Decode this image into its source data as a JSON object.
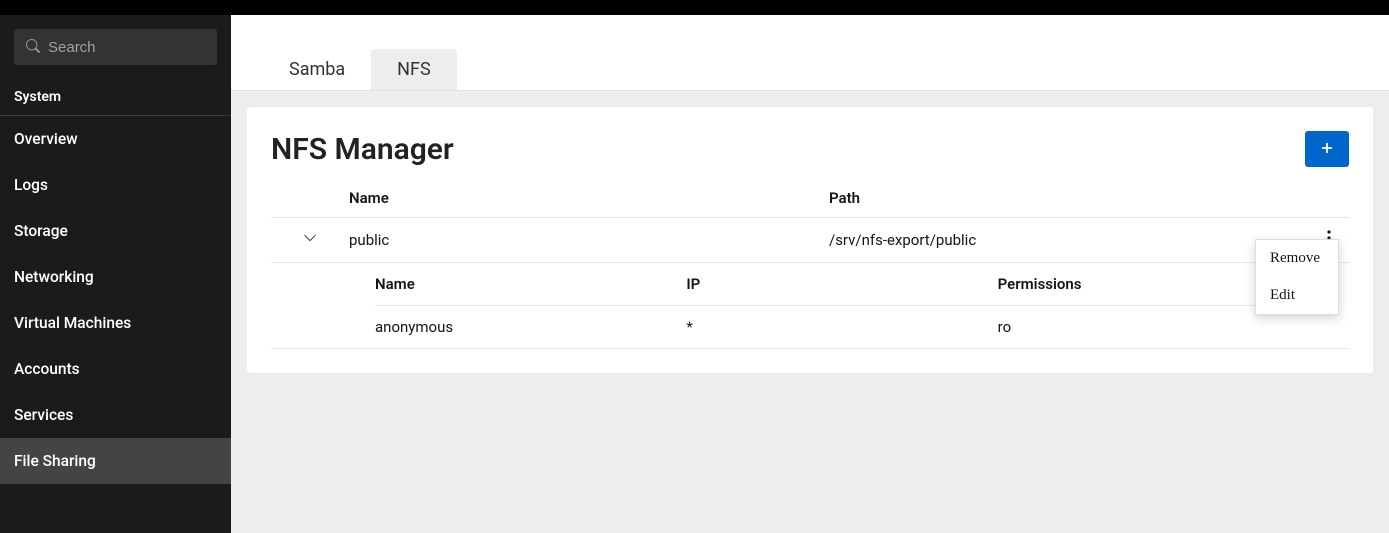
{
  "search": {
    "placeholder": "Search"
  },
  "sidebar": {
    "section": "System",
    "items": [
      {
        "label": "Overview",
        "active": false
      },
      {
        "label": "Logs",
        "active": false
      },
      {
        "label": "Storage",
        "active": false
      },
      {
        "label": "Networking",
        "active": false
      },
      {
        "label": "Virtual Machines",
        "active": false
      },
      {
        "label": "Accounts",
        "active": false
      },
      {
        "label": "Services",
        "active": false
      },
      {
        "label": "File Sharing",
        "active": true
      }
    ]
  },
  "tabs": [
    {
      "label": "Samba",
      "active": false
    },
    {
      "label": "NFS",
      "active": true
    }
  ],
  "card": {
    "title": "NFS Manager",
    "columns": {
      "name": "Name",
      "path": "Path"
    },
    "rows": [
      {
        "name": "public",
        "path": "/srv/nfs-export/public",
        "expanded": true
      }
    ],
    "sub_columns": {
      "name": "Name",
      "ip": "IP",
      "permissions": "Permissions"
    },
    "sub_rows": [
      {
        "name": "anonymous",
        "ip": "*",
        "permissions": "ro"
      }
    ]
  },
  "context_menu": {
    "items": [
      {
        "label": "Remove"
      },
      {
        "label": "Edit"
      }
    ]
  },
  "colors": {
    "accent": "#0066cc",
    "sidebar_bg": "#1b1b1b",
    "active_nav": "#444444"
  }
}
